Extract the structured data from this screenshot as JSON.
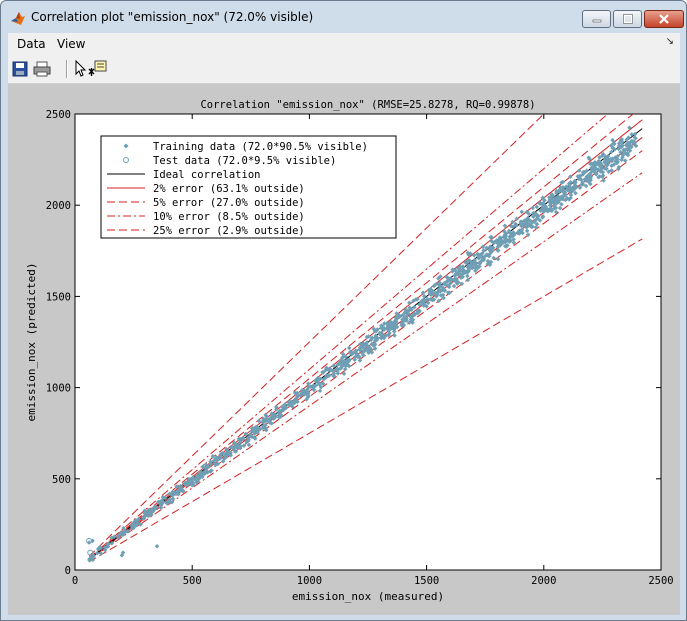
{
  "window": {
    "title": "Correlation plot \"emission_nox\" (72.0% visible)",
    "controls": {
      "minimize_icon": "minimize-icon",
      "maximize_icon": "maximize-icon",
      "close_icon": "close-icon"
    }
  },
  "menu": {
    "items": [
      "Data",
      "View"
    ],
    "overflow_icon": "chevron-icon"
  },
  "toolbar": {
    "icons": [
      "save-icon",
      "print-icon",
      "pointer-icon",
      "data-cursor-icon"
    ]
  },
  "chart_data": {
    "type": "scatter",
    "title": "Correlation \"emission_nox\" (RMSE=25.8278, RQ=0.99878)",
    "xlabel": "emission_nox (measured)",
    "ylabel": "emission_nox (predicted)",
    "xlim": [
      0,
      2500
    ],
    "ylim": [
      0,
      2500
    ],
    "xticks": [
      "0",
      "500",
      "1000",
      "1500",
      "2000",
      "2500"
    ],
    "yticks": [
      "0",
      "500",
      "1000",
      "1500",
      "2000",
      "2500"
    ],
    "grid": false,
    "legend_position": "top-left",
    "legend": [
      "Training data (72.0*90.5% visible)",
      "Test data (72.0*9.5% visible)",
      "Ideal correlation",
      "2% error (63.1% outside)",
      "5% error (27.0% outside)",
      "10% error (8.5% outside)",
      "25% error (2.9% outside)"
    ],
    "colors": {
      "training": "#6f9fb5",
      "ideal": "#000000",
      "error": "#d42020"
    },
    "reference_lines": {
      "x_range": [
        60,
        2420
      ],
      "ideal_slope": 1.0,
      "error_slopes": [
        {
          "pct": 2,
          "slopes": [
            0.98,
            1.02
          ],
          "style": "solid"
        },
        {
          "pct": 5,
          "slopes": [
            0.95,
            1.05
          ],
          "style": "dash"
        },
        {
          "pct": 10,
          "slopes": [
            0.9,
            1.1
          ],
          "style": "dashdot"
        },
        {
          "pct": 25,
          "slopes": [
            0.75,
            1.25
          ],
          "style": "dash"
        }
      ]
    },
    "training_outliers": [
      [
        60,
        150
      ],
      [
        75,
        160
      ],
      [
        350,
        130
      ],
      [
        200,
        80
      ],
      [
        205,
        95
      ]
    ],
    "test_points": [
      [
        60,
        160
      ],
      [
        65,
        95
      ]
    ]
  }
}
